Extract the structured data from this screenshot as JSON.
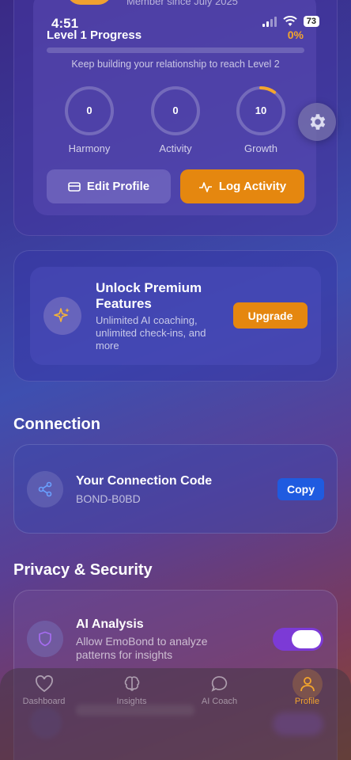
{
  "status_bar": {
    "time": "4:51",
    "battery": "73"
  },
  "profile": {
    "member_since": "Member since July 2025",
    "level_title": "Level 1 Progress",
    "level_percent_label": "0%",
    "level_progress": 0,
    "keep_building": "Keep building your relationship to reach Level 2",
    "stats": [
      {
        "label": "Harmony",
        "value": "0",
        "fraction": 0
      },
      {
        "label": "Activity",
        "value": "0",
        "fraction": 0
      },
      {
        "label": "Growth",
        "value": "10",
        "fraction": 0.1
      }
    ],
    "edit_label": "Edit Profile",
    "log_label": "Log Activity"
  },
  "premium": {
    "title": "Unlock Premium Features",
    "description": "Unlimited AI coaching, unlimited check-ins, and more",
    "upgrade_label": "Upgrade"
  },
  "connection": {
    "section_title": "Connection",
    "code_title": "Your Connection Code",
    "code_value": "BOND-B0BD",
    "copy_label": "Copy"
  },
  "privacy": {
    "section_title": "Privacy & Security",
    "ai_title": "AI Analysis",
    "ai_desc": "Allow EmoBond to analyze patterns for insights",
    "ai_enabled": true
  },
  "tabs": [
    {
      "label": "Dashboard",
      "icon": "heart-icon",
      "active": false
    },
    {
      "label": "Insights",
      "icon": "brain-icon",
      "active": false
    },
    {
      "label": "AI Coach",
      "icon": "chat-bubble-icon",
      "active": false
    },
    {
      "label": "Profile",
      "icon": "user-icon",
      "active": true
    }
  ],
  "colors": {
    "accent": "#f3a52c",
    "button_orange": "#e5870f",
    "copy_blue": "#1f5be0",
    "toggle_on": "#7c3ad6"
  }
}
